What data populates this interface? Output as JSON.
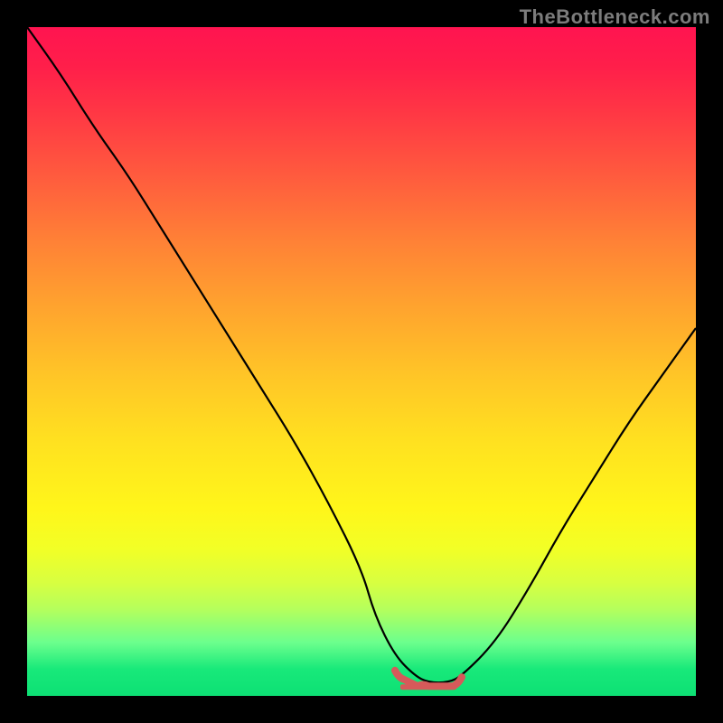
{
  "watermark": "TheBottleneck.com",
  "colors": {
    "curve_stroke": "#000000",
    "marker_stroke": "#d65a5a",
    "marker_fill": "#d65a5a"
  },
  "chart_data": {
    "type": "line",
    "title": "",
    "xlabel": "",
    "ylabel": "",
    "xlim": [
      0,
      100
    ],
    "ylim": [
      0,
      100
    ],
    "x": [
      0,
      5,
      10,
      15,
      20,
      25,
      30,
      35,
      40,
      45,
      50,
      52,
      55,
      58,
      60,
      63,
      65,
      70,
      75,
      80,
      85,
      90,
      95,
      100
    ],
    "values": [
      100,
      93,
      85,
      78,
      70,
      62,
      54,
      46,
      38,
      29,
      19,
      12,
      6,
      3,
      2,
      2,
      3,
      8,
      16,
      25,
      33,
      41,
      48,
      55
    ],
    "marker_region_x": [
      55,
      65
    ],
    "marker_region_y_approx": 2
  }
}
